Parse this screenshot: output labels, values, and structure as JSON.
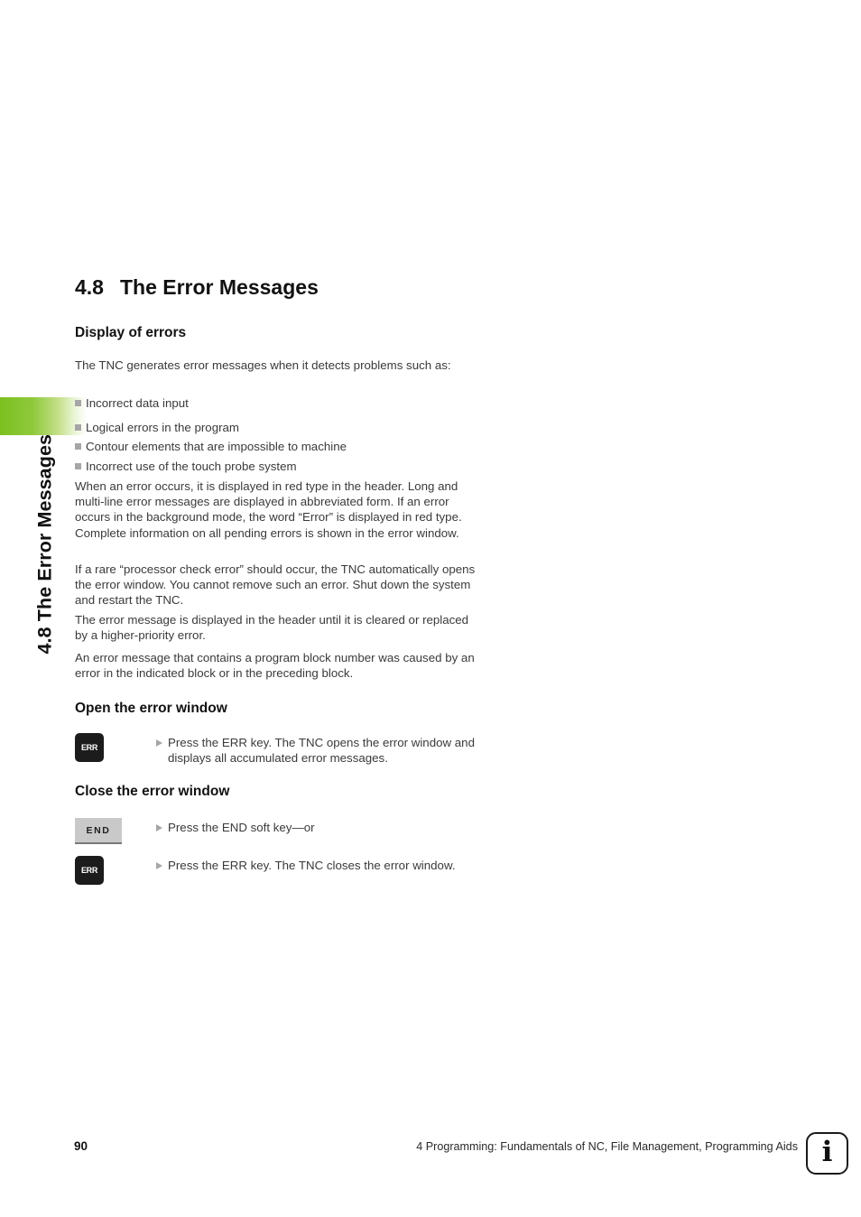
{
  "running_head": {
    "vertical_title": "4.8 The Error Messages",
    "tab_color": "#8fc93c"
  },
  "section": {
    "number": "4.8",
    "title": "The Error Messages"
  },
  "display_of_errors": {
    "heading": "Display of errors",
    "intro": "The TNC generates error messages when it detects problems such as:",
    "bullets": [
      "Incorrect data input",
      "Logical errors in the program",
      "Contour elements that are impossible to machine",
      "Incorrect use of the touch probe system"
    ],
    "paragraphs": [
      "When an error occurs, it is displayed in red type in the header. Long and multi-line error messages are displayed in abbreviated form. If an error occurs in the background mode, the word “Error” is displayed in red type. Complete information on all pending errors is shown in the error window.",
      "If a rare “processor check error” should occur, the TNC automatically opens the error window. You cannot remove such an error. Shut down the system and restart the TNC.",
      "The error message is displayed in the header until it is cleared or replaced by a higher-priority error.",
      "An error message that contains a program block number was caused by an error in the indicated block or in the preceding block."
    ]
  },
  "open_error_window": {
    "heading": "Open the error window",
    "key_label": "ERR",
    "step": "Press the ERR key. The TNC opens the error window and displays all accumulated error messages."
  },
  "close_error_window": {
    "heading": "Close the error window",
    "end_key_label": "END",
    "end_step": "Press the END soft key—or",
    "err_key_label": "ERR",
    "err_step": "Press the ERR key. The TNC closes the error window."
  },
  "footer": {
    "page_number": "90",
    "chapter": "4 Programming: Fundamentals of NC, File Management, Programming Aids",
    "info_glyph": "i"
  }
}
